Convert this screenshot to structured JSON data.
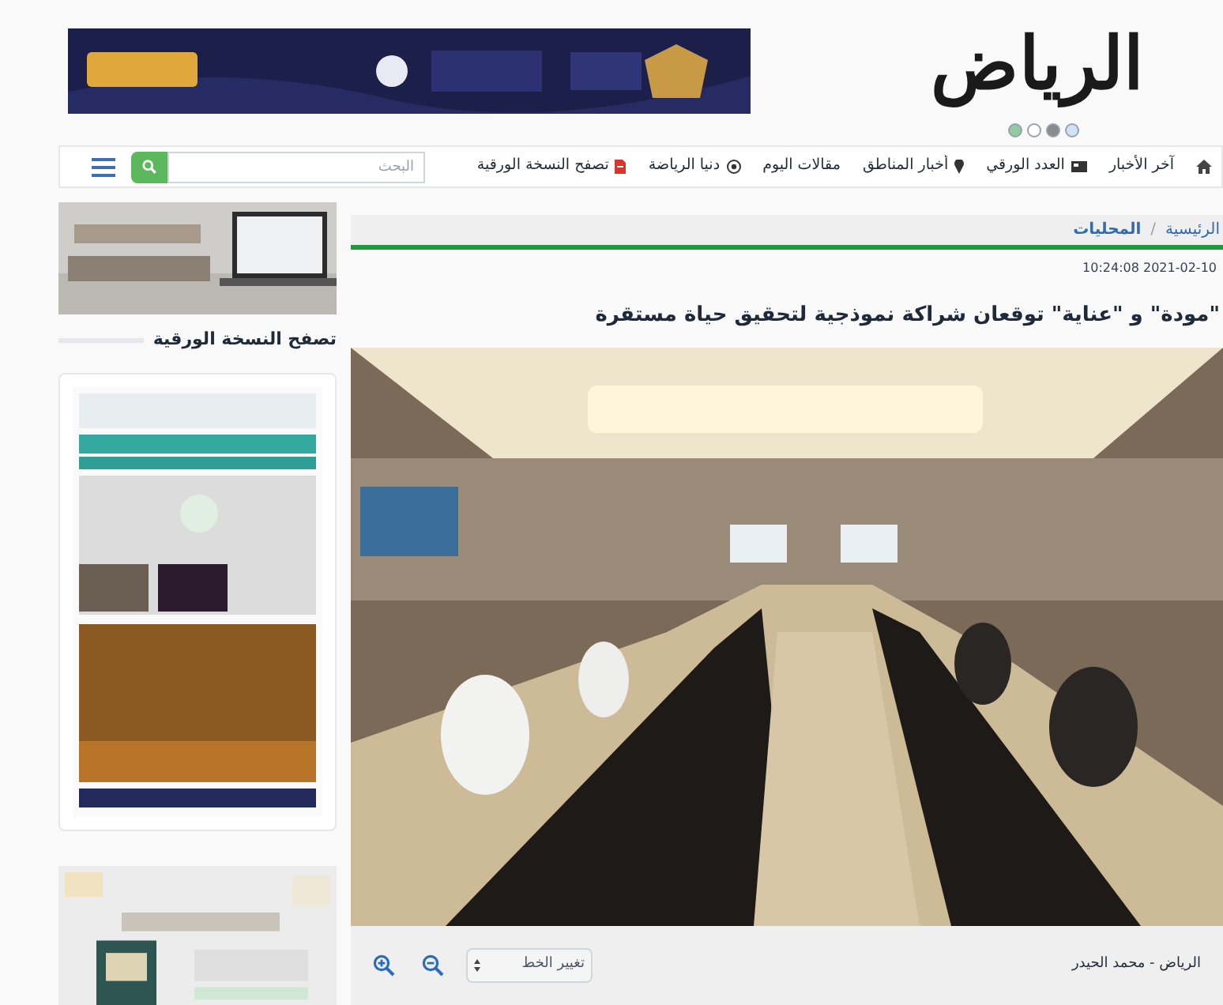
{
  "header": {
    "logo": "الرياض",
    "slider_dots": [
      {
        "color": "#8fcaa0"
      },
      {
        "color": "#ffffff"
      },
      {
        "color": "#8a8a8a"
      },
      {
        "color": "#cfe3f5"
      }
    ]
  },
  "nav": {
    "items": [
      {
        "kind": "home"
      },
      {
        "kind": "text",
        "label": "آخر الأخبار"
      },
      {
        "kind": "paper",
        "label": "العدد الورقي"
      },
      {
        "kind": "pin",
        "label": "أخبار المناطق"
      },
      {
        "kind": "text",
        "label": "مقالات اليوم"
      },
      {
        "kind": "ball",
        "label": "دنيا الرياضة"
      },
      {
        "kind": "pdf",
        "label": "تصفح النسخة الورقية"
      }
    ],
    "search": {
      "placeholder": "البحث"
    }
  },
  "sidebar": {
    "heading": "تصفح النسخة الورقية"
  },
  "article": {
    "breadcrumb_separator": "/",
    "breadcrumbs": [
      {
        "label": "الرئيسية"
      },
      {
        "label": "المحليات"
      }
    ],
    "date": "10:24:08 2021-02-10",
    "title": "\"مودة\" و \"عناية\" توقعان شراكة نموذجية لتحقيق حياة مستقرة",
    "credit": "الرياض - محمد الحيدر",
    "font_select": {
      "value": "تغيير الخط"
    }
  }
}
